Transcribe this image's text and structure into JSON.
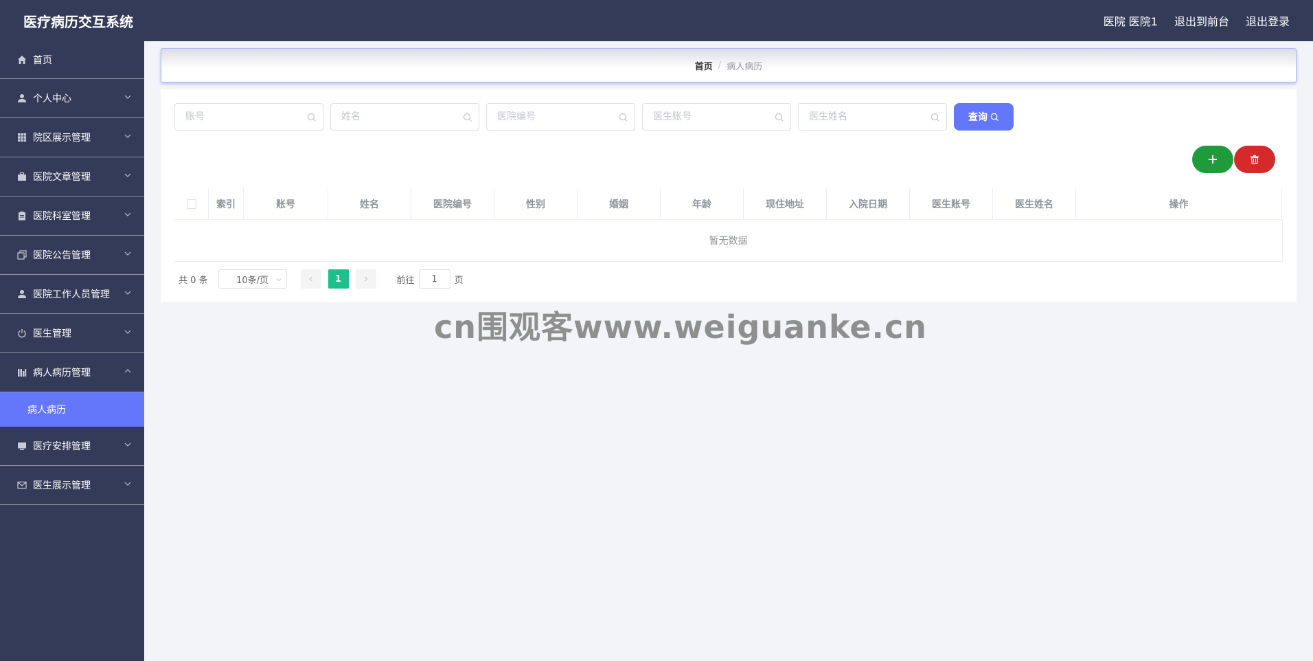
{
  "header": {
    "title": "医疗病历交互系统",
    "links": [
      "医院 医院1",
      "退出到前台",
      "退出登录"
    ]
  },
  "sidebar": {
    "items": [
      {
        "label": "首页",
        "icon": "home-icon"
      },
      {
        "label": "个人中心",
        "icon": "user-icon"
      },
      {
        "label": "院区展示管理",
        "icon": "grid-icon"
      },
      {
        "label": "医院文章管理",
        "icon": "briefcase-icon"
      },
      {
        "label": "医院科室管理",
        "icon": "clipboard-icon"
      },
      {
        "label": "医院公告管理",
        "icon": "copy-icon"
      },
      {
        "label": "医院工作人员管理",
        "icon": "user-icon"
      },
      {
        "label": "医生管理",
        "icon": "power-icon"
      },
      {
        "label": "病人病历管理",
        "icon": "chart-icon"
      },
      {
        "label": "医疗安排管理",
        "icon": "monitor-icon"
      },
      {
        "label": "医生展示管理",
        "icon": "mail-icon"
      }
    ],
    "submenu_active": "病人病历"
  },
  "breadcrumb": {
    "home": "首页",
    "separator": "/",
    "current": "病人病历"
  },
  "search": {
    "fields": [
      {
        "placeholder": "账号"
      },
      {
        "placeholder": "姓名"
      },
      {
        "placeholder": "医院编号"
      },
      {
        "placeholder": "医生账号"
      },
      {
        "placeholder": "医生姓名"
      }
    ],
    "query_label": "查询"
  },
  "table": {
    "columns": [
      "索引",
      "账号",
      "姓名",
      "医院编号",
      "性别",
      "婚姻",
      "年龄",
      "现住地址",
      "入院日期",
      "医生账号",
      "医生姓名",
      "操作"
    ],
    "empty_text": "暂无数据"
  },
  "pagination": {
    "total": "共 0 条",
    "page_size": "10条/页",
    "current_page": "1",
    "goto_label": "前往",
    "goto_value": "1",
    "page_unit": "页"
  },
  "watermark": "cn围观客www.weiguanke.cn",
  "colors": {
    "nav_bg": "#343b58",
    "accent": "#6477fb",
    "add": "#1f9b3c",
    "delete": "#d42a2a",
    "page_active": "#1dc08b"
  }
}
